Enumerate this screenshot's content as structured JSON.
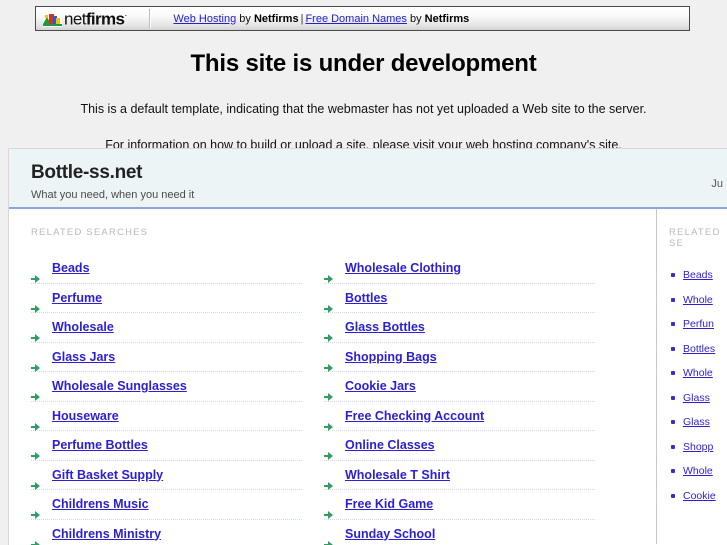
{
  "netfirms_bar": {
    "logo_net": "net",
    "logo_firms": "firms",
    "logo_tm": "·",
    "link_web_hosting": "Web Hosting",
    "by_1": "by",
    "brand_1": "Netfirms",
    "pipe": "|",
    "link_free_domain": "Free Domain Names",
    "by_2": "by",
    "brand_2": "Netfirms"
  },
  "notice": {
    "heading": "This site is under development",
    "line1": "This is a default template, indicating that the webmaster has not yet uploaded a Web site to the server.",
    "line2": "For information on how to build or upload a site, please visit your web hosting company's site."
  },
  "parked_panel": {
    "domain": "Bottle-ss.net",
    "tagline": "What you need, when you need it",
    "head_right_text": "Ju",
    "section_label": "RELATED SEARCHES",
    "rail_section_label": "RELATED SE",
    "columns": [
      {
        "items": [
          "Beads",
          "Perfume",
          "Wholesale",
          "Glass Jars",
          "Wholesale Sunglasses",
          "Houseware",
          "Perfume Bottles",
          "Gift Basket Supply",
          "Childrens Music",
          "Childrens Ministry"
        ]
      },
      {
        "items": [
          "Wholesale Clothing",
          "Bottles",
          "Glass Bottles",
          "Shopping Bags",
          "Cookie Jars",
          "Free Checking Account",
          "Online Classes",
          "Wholesale T Shirt",
          "Free Kid Game",
          "Sunday School"
        ]
      }
    ],
    "rail_items": [
      "Beads",
      "Whole",
      "Perfun",
      "Bottles",
      "Whole",
      "Glass",
      "Glass",
      "Shopp",
      "Whole",
      "Cookie"
    ]
  },
  "colors": {
    "link_blue": "#2b1fd1",
    "header_band": "#edf4f6",
    "header_rule": "#8ba7dd",
    "bullet_green": "#2f9e63",
    "page_bg": "#f0f0f0",
    "label_gray": "#b9b9b9"
  }
}
